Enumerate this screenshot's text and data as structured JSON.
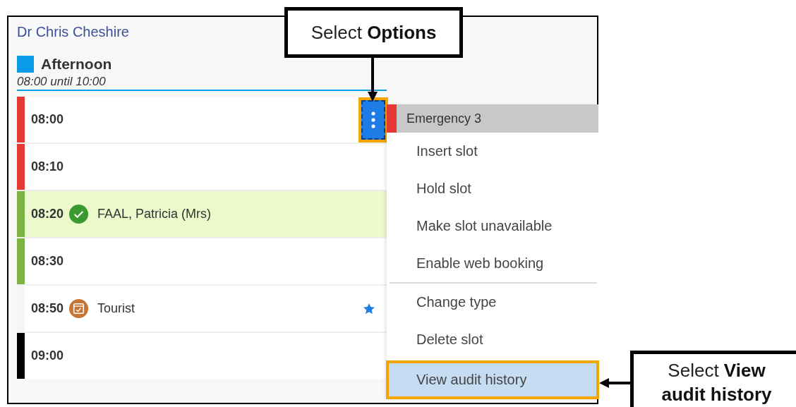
{
  "clinician": "Dr Chris Cheshire",
  "session": {
    "name": "Afternoon",
    "color": "#0a9be6",
    "hours": "08:00 until 10:00"
  },
  "slots": [
    {
      "time": "08:00",
      "color": "#e53935",
      "booked": false,
      "kind": "empty",
      "starred": false,
      "options_open": true
    },
    {
      "time": "08:10",
      "color": "#e53935",
      "booked": false,
      "kind": "empty",
      "starred": false,
      "options_open": false
    },
    {
      "time": "08:20",
      "color": "#7cb342",
      "booked": true,
      "kind": "arrived",
      "patient": "FAAL, Patricia (Mrs)",
      "starred": false,
      "options_open": false
    },
    {
      "time": "08:30",
      "color": "#7cb342",
      "booked": false,
      "kind": "empty",
      "starred": false,
      "options_open": false
    },
    {
      "time": "08:50",
      "color": "#f5f5f5",
      "booked": false,
      "kind": "reserved",
      "patient": "Tourist",
      "starred": true,
      "options_open": false
    },
    {
      "time": "09:00",
      "color": "#000000",
      "booked": false,
      "kind": "empty",
      "starred": false,
      "options_open": false
    }
  ],
  "options_menu": {
    "title": "Emergency 3",
    "color": "#e53935",
    "items": [
      {
        "label": "Insert slot",
        "divider_before": false,
        "selected": false
      },
      {
        "label": "Hold slot",
        "divider_before": false,
        "selected": false
      },
      {
        "label": "Make slot unavailable",
        "divider_before": false,
        "selected": false
      },
      {
        "label": "Enable web booking",
        "divider_before": false,
        "selected": false
      },
      {
        "label": "Change type",
        "divider_before": true,
        "selected": false
      },
      {
        "label": "Delete slot",
        "divider_before": false,
        "selected": false
      },
      {
        "label": "View audit history",
        "divider_before": false,
        "selected": true
      }
    ]
  },
  "callouts": [
    {
      "text": "Select **Options**",
      "kind": "down"
    },
    {
      "text": "Select **View audit history**",
      "kind": "left"
    }
  ]
}
